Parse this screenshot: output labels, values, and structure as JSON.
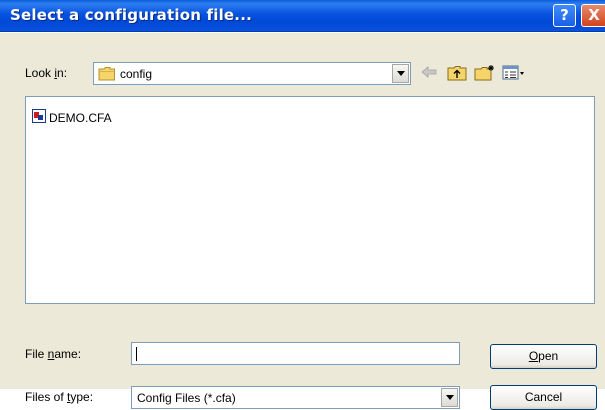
{
  "window": {
    "title": "Select a configuration file...",
    "help_glyph": "?",
    "close_glyph": "X"
  },
  "lookin": {
    "label_pre": "Look ",
    "label_accel": "i",
    "label_post": "n:",
    "value": "config"
  },
  "files": [
    {
      "name": "DEMO.CFA",
      "icon": "cfa-file-icon"
    }
  ],
  "filename": {
    "label_pre": "File ",
    "label_accel": "n",
    "label_post": "ame:",
    "value": ""
  },
  "filetype": {
    "label_pre": "Files of ",
    "label_accel": "t",
    "label_post": "ype:",
    "value": "Config Files (*.cfa)"
  },
  "buttons": {
    "open_accel": "O",
    "open_rest": "pen",
    "cancel": "Cancel"
  },
  "colors": {
    "titlebar": "#0753e0",
    "face": "#ece9d8",
    "field_border": "#7f9db9",
    "button_border": "#003c74"
  }
}
